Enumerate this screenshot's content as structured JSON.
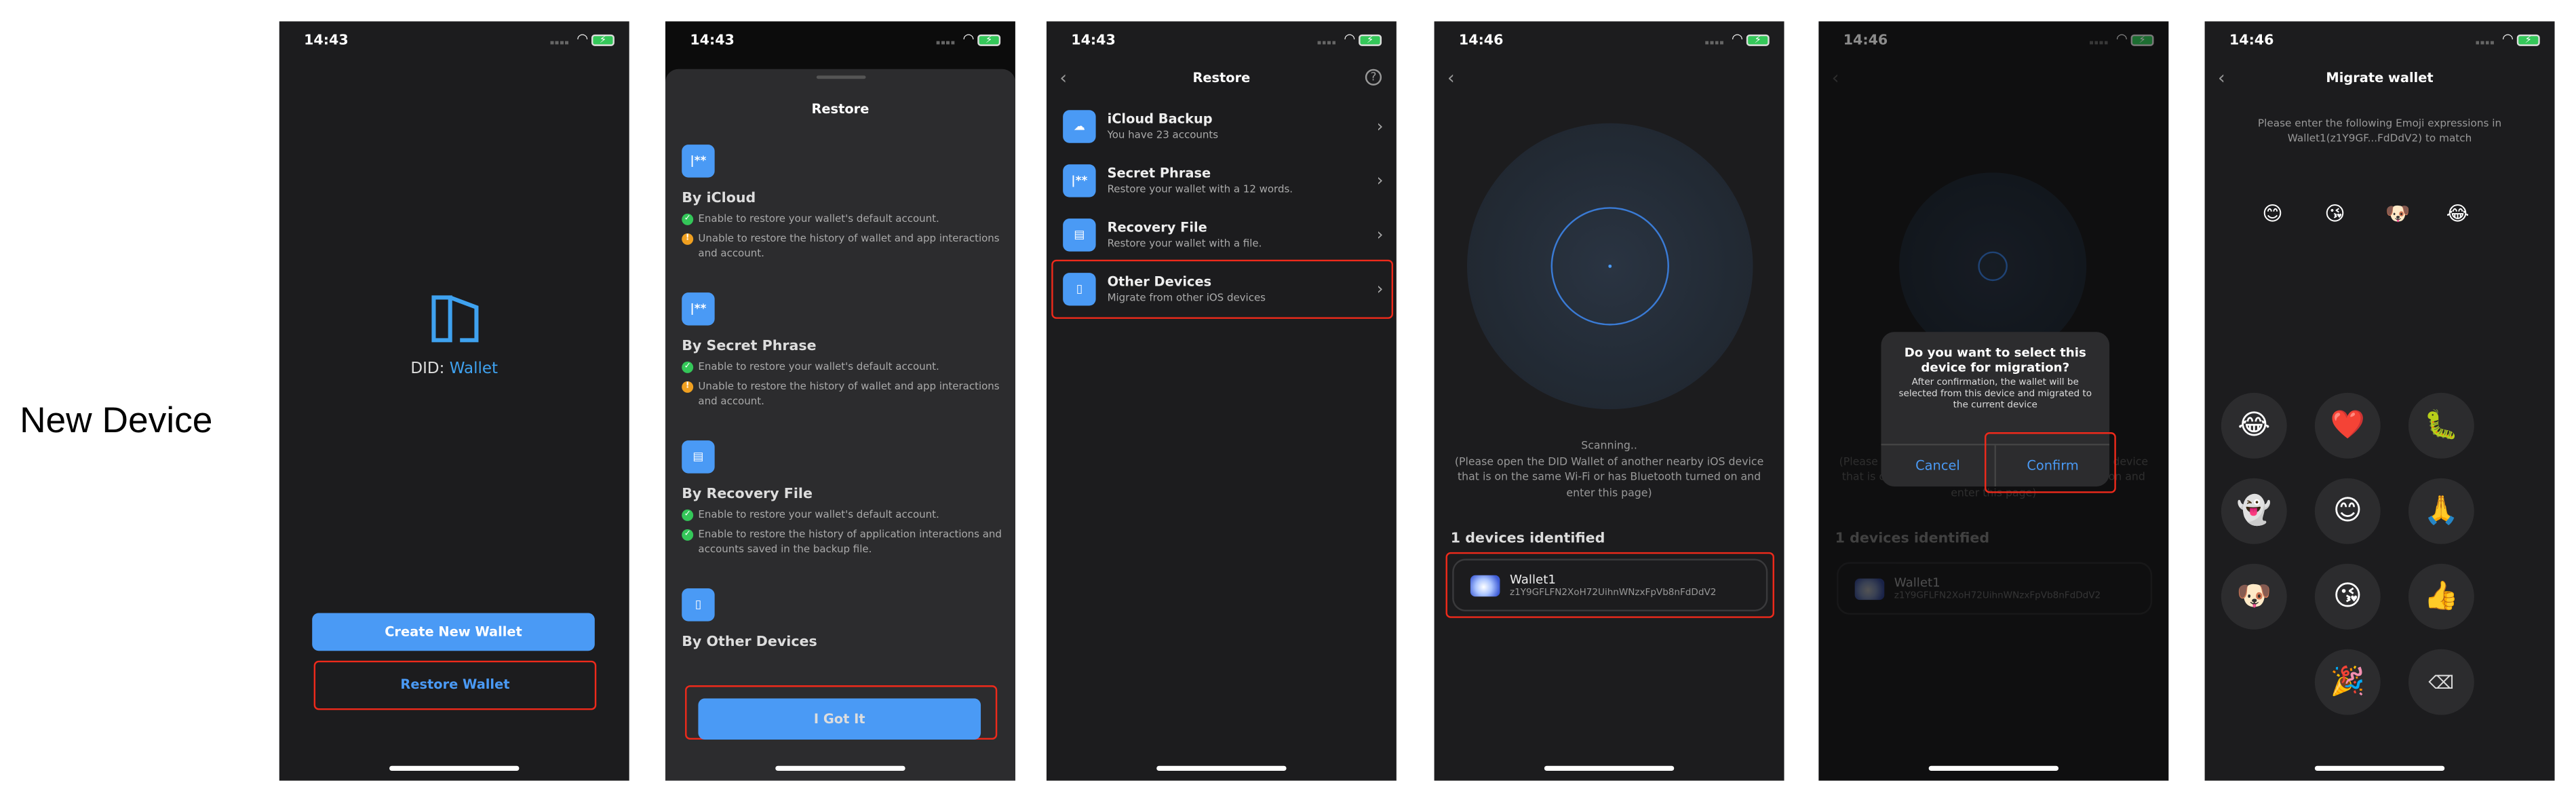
{
  "side_label": "New Device",
  "status": {
    "time_1": "14:43",
    "time_2": "14:46"
  },
  "screen1": {
    "logo_text_a": "DID:",
    "logo_text_b": "Wallet",
    "create_button": "Create New Wallet",
    "restore_button": "Restore Wallet"
  },
  "screen2": {
    "title": "Restore",
    "sections": [
      {
        "icon": "password-icon",
        "title": "By iCloud",
        "bullets": [
          {
            "type": "ok",
            "text": "Enable to restore your wallet's default account."
          },
          {
            "type": "warn",
            "text": "Unable to restore the history of wallet and app interactions and account."
          }
        ]
      },
      {
        "icon": "password-icon",
        "title": "By Secret Phrase",
        "bullets": [
          {
            "type": "ok",
            "text": "Enable to restore your wallet's default account."
          },
          {
            "type": "warn",
            "text": "Unable to restore the history of wallet and app interactions and account."
          }
        ]
      },
      {
        "icon": "file-icon",
        "title": "By Recovery File",
        "bullets": [
          {
            "type": "ok",
            "text": "Enable to restore your wallet's default account."
          },
          {
            "type": "ok",
            "text": "Enable to restore the history of application interactions and accounts saved in the backup file."
          }
        ]
      },
      {
        "icon": "phone-icon",
        "title": "By Other Devices"
      }
    ],
    "button": "I Got It"
  },
  "screen3": {
    "title": "Restore",
    "rows": [
      {
        "icon": "cloud-icon",
        "title": "iCloud Backup",
        "subtitle": "You have 23 accounts"
      },
      {
        "icon": "password-icon",
        "title": "Secret Phrase",
        "subtitle": "Restore your wallet with a 12 words."
      },
      {
        "icon": "file-icon",
        "title": "Recovery File",
        "subtitle": "Restore your wallet with a file."
      },
      {
        "icon": "phone-icon",
        "title": "Other Devices",
        "subtitle": "Migrate from other iOS devices"
      }
    ]
  },
  "screen4": {
    "scanning": "Scanning..",
    "instructions": "(Please open the DID Wallet of another nearby iOS device that is on the same Wi-Fi or has Bluetooth turned on and enter this page)",
    "identified": "1 devices identified",
    "device": {
      "name": "Wallet1",
      "address": "z1Y9GFLFN2XoH72UihnWNzxFpVb8nFdDdV2"
    }
  },
  "screen5": {
    "dialog_title": "Do you want to select this device for migration?",
    "dialog_message": "After confirmation, the wallet will be selected from this device and migrated to the current device",
    "cancel": "Cancel",
    "confirm": "Confirm"
  },
  "screen6": {
    "title": "Migrate wallet",
    "instructions": "Please enter the following Emoji expressions in Wallet1(z1Y9GF...FdDdV2) to match",
    "target_emojis": [
      "😊",
      "😘",
      "🐶",
      "😂"
    ],
    "keypad": [
      "😂",
      "❤️",
      "🐛",
      "👻",
      "😊",
      "🙏",
      "🐶",
      "😘",
      "👍",
      "",
      "🎉",
      "⌫"
    ]
  },
  "colors": {
    "accent": "#4a9af5",
    "highlight": "#ee2a1b",
    "background": "#1c1c1e",
    "ok": "#34c759",
    "warn": "#f0a020"
  }
}
